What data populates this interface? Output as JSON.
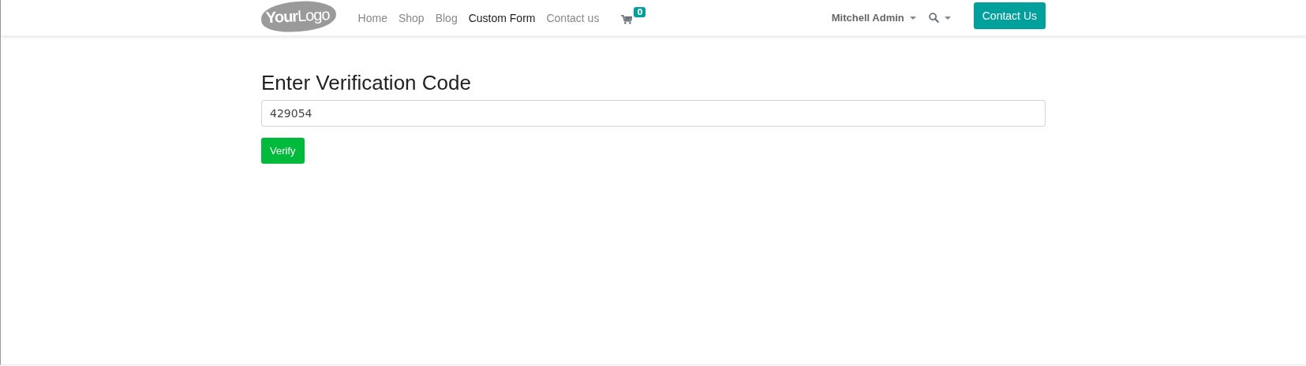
{
  "navbar": {
    "logo": "**Your**Logo",
    "menu": [
      {
        "label": "Home",
        "selected": false
      },
      {
        "label": "Shop",
        "selected": false
      },
      {
        "label": "Blog",
        "selected": false
      },
      {
        "label": "Custom Form",
        "selected": true
      },
      {
        "label": "Contact us",
        "selected": false
      }
    ],
    "cart_count": "0",
    "user": "Mitchell Admin",
    "cta": "Contact Us"
  },
  "form": {
    "title": "Enter Verification Code",
    "code": "429054",
    "button": "Verify"
  }
}
